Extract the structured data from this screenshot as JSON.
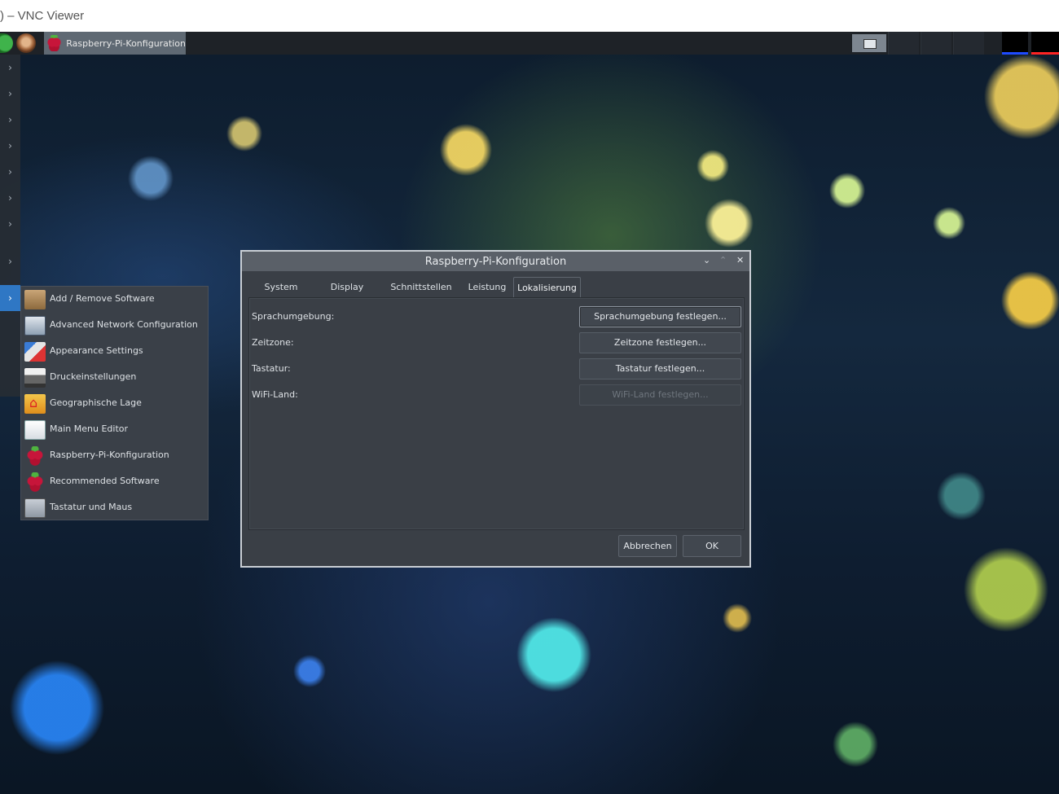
{
  "window": {
    "title": ") – VNC Viewer"
  },
  "taskbar": {
    "task_label": "Raspberry-Pi-Konfiguration"
  },
  "submenu": {
    "items": [
      {
        "label": "Add / Remove Software",
        "icon": "package-icon"
      },
      {
        "label": "Advanced Network Configuration",
        "icon": "network-config-icon"
      },
      {
        "label": "Appearance Settings",
        "icon": "appearance-icon"
      },
      {
        "label": "Druckeinstellungen",
        "icon": "printer-icon"
      },
      {
        "label": "Geographische Lage",
        "icon": "home-folder-icon"
      },
      {
        "label": "Main Menu Editor",
        "icon": "menu-editor-icon"
      },
      {
        "label": "Raspberry-Pi-Konfiguration",
        "icon": "raspberry-icon"
      },
      {
        "label": "Recommended Software",
        "icon": "raspberry-icon"
      },
      {
        "label": "Tastatur und Maus",
        "icon": "keyboard-mouse-icon"
      }
    ]
  },
  "dialog": {
    "title": "Raspberry-Pi-Konfiguration",
    "controls": {
      "minimize": "⌄",
      "maximize": "⌃",
      "close": "✕"
    },
    "tabs": [
      {
        "label": "System"
      },
      {
        "label": "Display"
      },
      {
        "label": "Schnittstellen"
      },
      {
        "label": "Leistung"
      },
      {
        "label": "Lokalisierung",
        "active": true
      }
    ],
    "rows": [
      {
        "label": "Sprachumgebung:",
        "button": "Sprachumgebung festlegen..."
      },
      {
        "label": "Zeitzone:",
        "button": "Zeitzone festlegen..."
      },
      {
        "label": "Tastatur:",
        "button": "Tastatur festlegen..."
      },
      {
        "label": "WiFi-Land:",
        "button": "WiFi-Land festlegen..."
      }
    ],
    "cancel_label": "Abbrechen",
    "ok_label": "OK"
  },
  "colors": {
    "accent": "#2f77c4",
    "dialog_bg": "#3a3f46",
    "taskbar_bg": "#1e2227"
  }
}
